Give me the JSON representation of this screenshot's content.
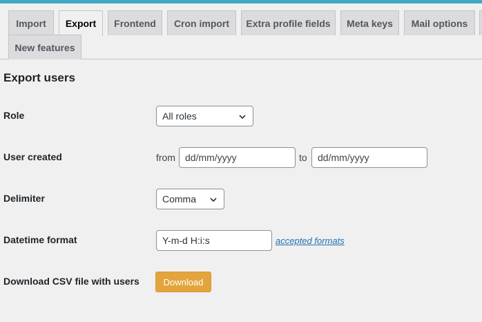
{
  "tabs": [
    {
      "label": "Import",
      "active": false
    },
    {
      "label": "Export",
      "active": true
    },
    {
      "label": "Frontend",
      "active": false
    },
    {
      "label": "Cron import",
      "active": false
    },
    {
      "label": "Extra profile fields",
      "active": false
    },
    {
      "label": "Meta keys",
      "active": false
    },
    {
      "label": "Mail options",
      "active": false
    },
    {
      "label": "New features",
      "active": false
    }
  ],
  "section_title": "Export users",
  "form": {
    "role": {
      "label": "Role",
      "value": "All roles",
      "icon": "chevron-down-icon"
    },
    "user_created": {
      "label": "User created",
      "from_text": "from",
      "to_text": "to",
      "from_placeholder": "dd/mm/yyyy",
      "to_placeholder": "dd/mm/yyyy"
    },
    "delimiter": {
      "label": "Delimiter",
      "value": "Comma",
      "icon": "chevron-down-icon"
    },
    "datetime_format": {
      "label": "Datetime format",
      "value": "Y-m-d H:i:s",
      "link_text": "accepted formats"
    },
    "download": {
      "label": "Download CSV file with users",
      "button_label": "Download"
    }
  },
  "colors": {
    "top_strip": "#3fa9c6",
    "download_button": "#e2a53c",
    "link": "#2271b1",
    "background": "#f0f0f1"
  }
}
